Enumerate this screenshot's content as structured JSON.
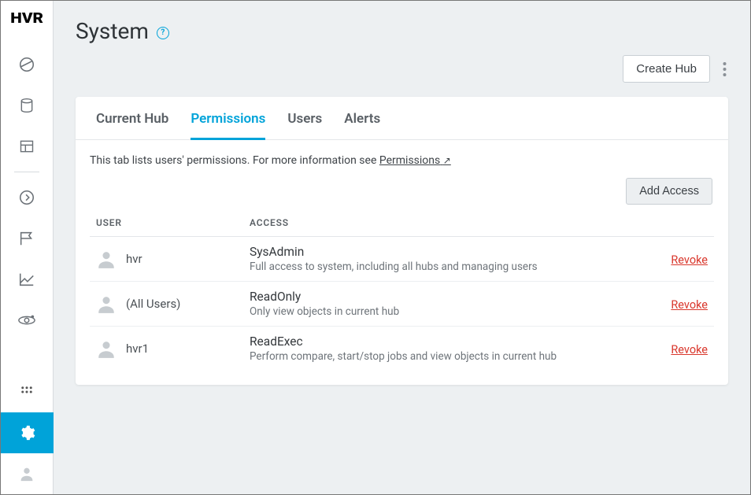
{
  "logo": "HVR",
  "page_title": "System",
  "help_glyph": "?",
  "create_hub_label": "Create Hub",
  "tabs": [
    {
      "label": "Current Hub",
      "active": false
    },
    {
      "label": "Permissions",
      "active": true
    },
    {
      "label": "Users",
      "active": false
    },
    {
      "label": "Alerts",
      "active": false
    }
  ],
  "description_text": "This tab lists users' permissions. For more information see ",
  "description_link": "Permissions",
  "add_access_label": "Add Access",
  "columns": {
    "user": "USER",
    "access": "ACCESS"
  },
  "rows": [
    {
      "user": "hvr",
      "access_title": "SysAdmin",
      "access_desc": "Full access to system, including all hubs and managing users",
      "action": "Revoke"
    },
    {
      "user": "(All Users)",
      "access_title": "ReadOnly",
      "access_desc": "Only view objects in current hub",
      "action": "Revoke"
    },
    {
      "user": "hvr1",
      "access_title": "ReadExec",
      "access_desc": "Perform compare, start/stop jobs and view objects in current hub",
      "action": "Revoke"
    }
  ]
}
